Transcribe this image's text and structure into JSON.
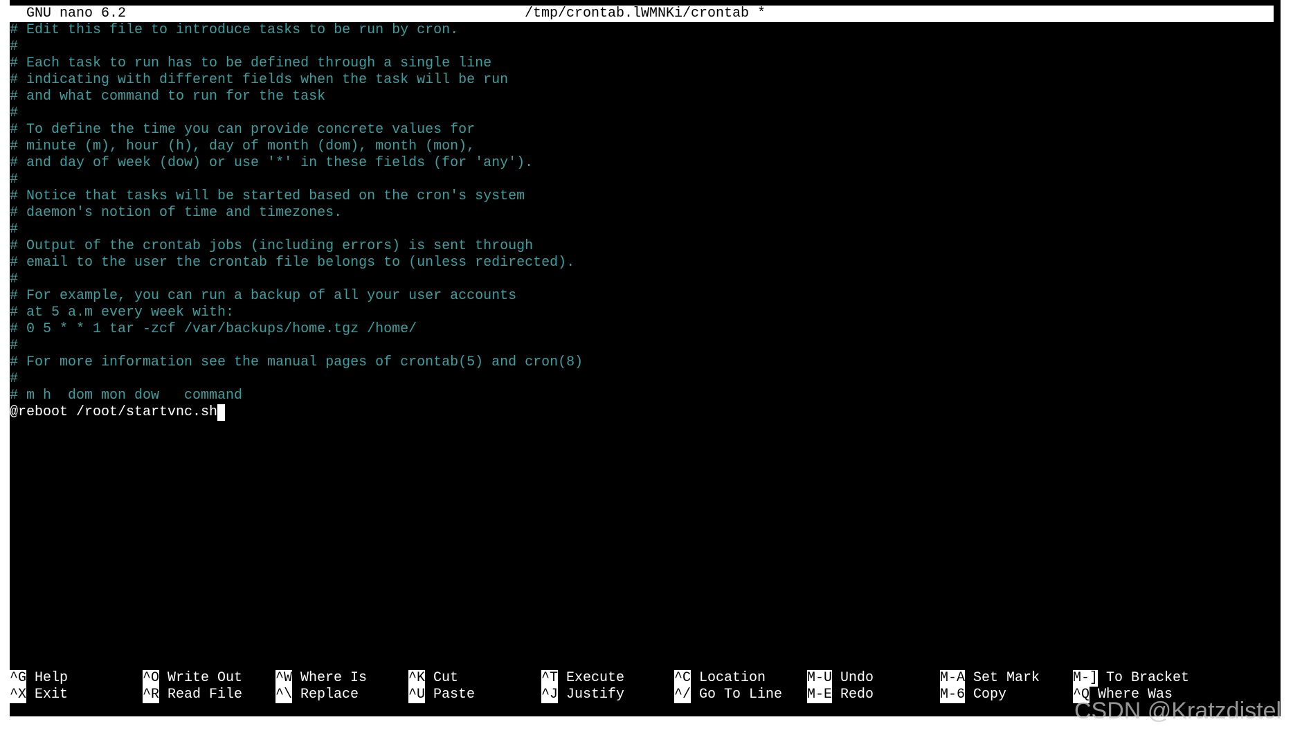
{
  "title_bar": {
    "app_name": "GNU nano 6.2",
    "file_path": "/tmp/crontab.lWMNKi/crontab *"
  },
  "editor": {
    "lines": [
      "# Edit this file to introduce tasks to be run by cron.",
      "#",
      "# Each task to run has to be defined through a single line",
      "# indicating with different fields when the task will be run",
      "# and what command to run for the task",
      "#",
      "# To define the time you can provide concrete values for",
      "# minute (m), hour (h), day of month (dom), month (mon),",
      "# and day of week (dow) or use '*' in these fields (for 'any').",
      "#",
      "# Notice that tasks will be started based on the cron's system",
      "# daemon's notion of time and timezones.",
      "#",
      "# Output of the crontab jobs (including errors) is sent through",
      "# email to the user the crontab file belongs to (unless redirected).",
      "#",
      "# For example, you can run a backup of all your user accounts",
      "# at 5 a.m every week with:",
      "# 0 5 * * 1 tar -zcf /var/backups/home.tgz /home/",
      "#",
      "# For more information see the manual pages of crontab(5) and cron(8)",
      "#",
      "# m h  dom mon dow   command"
    ],
    "active_line": "@reboot /root/startvnc.sh"
  },
  "shortcuts": {
    "row1": [
      {
        "key": "^G",
        "label": "Help"
      },
      {
        "key": "^O",
        "label": "Write Out"
      },
      {
        "key": "^W",
        "label": "Where Is"
      },
      {
        "key": "^K",
        "label": "Cut"
      },
      {
        "key": "^T",
        "label": "Execute"
      },
      {
        "key": "^C",
        "label": "Location"
      },
      {
        "key": "M-U",
        "label": "Undo"
      },
      {
        "key": "M-A",
        "label": "Set Mark"
      },
      {
        "key": "M-]",
        "label": "To Bracket"
      }
    ],
    "row2": [
      {
        "key": "^X",
        "label": "Exit"
      },
      {
        "key": "^R",
        "label": "Read File"
      },
      {
        "key": "^\\",
        "label": "Replace"
      },
      {
        "key": "^U",
        "label": "Paste"
      },
      {
        "key": "^J",
        "label": "Justify"
      },
      {
        "key": "^/",
        "label": "Go To Line"
      },
      {
        "key": "M-E",
        "label": "Redo"
      },
      {
        "key": "M-6",
        "label": "Copy"
      },
      {
        "key": "^Q",
        "label": "Where Was"
      }
    ]
  },
  "watermark": "CSDN @Kratzdistel",
  "colors": {
    "comment": "#3aa0a0",
    "background": "#000000",
    "text": "#ffffff"
  }
}
